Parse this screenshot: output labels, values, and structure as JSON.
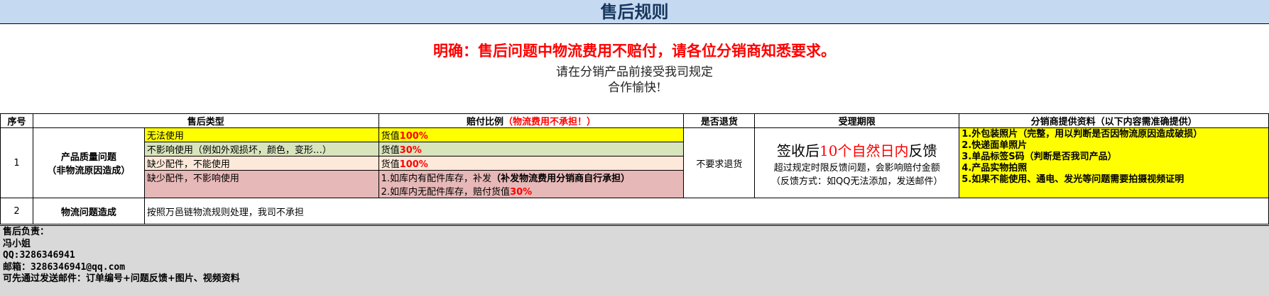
{
  "title": "售后规则",
  "notice": {
    "highlight": "明确：售后问题中物流费用不赔付，请各位分销商知悉要求。",
    "line1": "请在分销产品前接受我司规定",
    "line2": "合作愉快!"
  },
  "table": {
    "headers": {
      "no": "序号",
      "type": "售后类型",
      "ratio_prefix": "赔付比例",
      "ratio_note": "（物流费用不承担！）",
      "return": "是否退货",
      "period": "受理期限",
      "docs": "分销商提供资料（以下内容需准确提供）"
    },
    "row1": {
      "no": "1",
      "category_line1": "产品质量问题",
      "category_line2": "（非物流原因造成）",
      "sub": [
        {
          "type": "无法使用",
          "ratio_text": "货值",
          "ratio_pct": "100%"
        },
        {
          "type": "不影响使用（例如外观损坏，颜色，变形…）",
          "ratio_text": "货值",
          "ratio_pct": "30%"
        },
        {
          "type": "缺少配件，不能使用",
          "ratio_text": "货值",
          "ratio_pct": "100%"
        },
        {
          "type": "缺少配件，不影响使用",
          "ratio_line1_text": "1.如库内有配件库存，补发",
          "ratio_line1_bold": "（补发物流费用分销商自行承担）",
          "ratio_line2_text": "2.如库内无配件库存，赔付货值",
          "ratio_line2_pct": "30%"
        }
      ],
      "return": "不要求退货",
      "period_a": "签收后",
      "period_b": "10个自然日内",
      "period_c": "反馈",
      "period_line2": "超过规定时限反馈问题，会影响赔付金额",
      "period_line3": "（反馈方式：如QQ无法添加，发送邮件）",
      "docs": [
        "1.外包装照片（完整，用以判断是否因物流原因造成破损）",
        "2.快递面单照片",
        "3.单品标签S码（判断是否我司产品）",
        "4.产品实物拍照",
        "5.如果不能使用、通电、发光等问题需要拍摄视频证明"
      ]
    },
    "row2": {
      "no": "2",
      "category": "物流问题造成",
      "desc": "按照万邑链物流规则处理，我司不承担"
    }
  },
  "footer": {
    "label": "售后负责：",
    "name": "冯小姐",
    "qq": "QQ:3286346941",
    "email": "邮箱：3286346941@qq.com",
    "note": "可先通过发送邮件：订单编号+问题反馈+图片、视频资料"
  },
  "colors": {
    "title_bg": "#c5d9f1",
    "yellow": "#ffff00",
    "green": "#d8e4bc",
    "peach": "#fde9d9",
    "pink": "#e6b8b7",
    "footer_bg": "#d9d9d9",
    "red": "#ff0000"
  }
}
